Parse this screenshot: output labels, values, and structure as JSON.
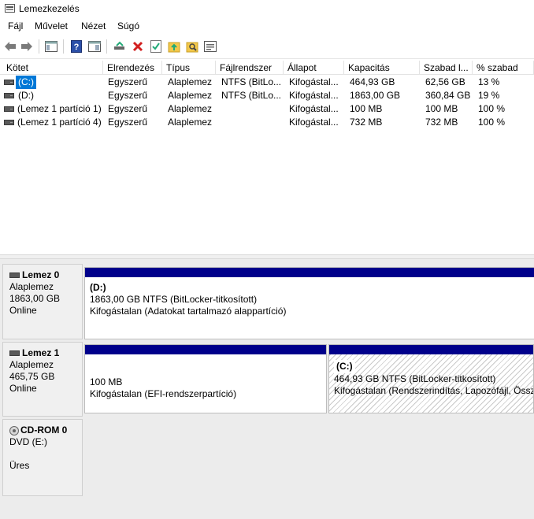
{
  "window": {
    "title": "Lemezkezelés"
  },
  "menu": [
    "Fájl",
    "Művelet",
    "Nézet",
    "Súgó"
  ],
  "toolbar": {
    "icons": [
      "back-arrow-icon",
      "forward-arrow-icon",
      "console-tree-icon",
      "help-icon",
      "show-pane-icon",
      "connect-icon",
      "delete-icon",
      "properties-icon",
      "folder-up-icon",
      "search-icon",
      "settings-list-icon"
    ]
  },
  "columns": [
    "Kötet",
    "Elrendezés",
    "Típus",
    "Fájlrendszer",
    "Állapot",
    "Kapacitás",
    "Szabad l...",
    "% szabad"
  ],
  "volumes": [
    {
      "name": "(C:)",
      "layout": "Egyszerű",
      "type": "Alaplemez",
      "fs": "NTFS (BitLo...",
      "status": "Kifogástal...",
      "capacity": "464,93 GB",
      "free": "62,56 GB",
      "pct": "13 %"
    },
    {
      "name": "(D:)",
      "layout": "Egyszerű",
      "type": "Alaplemez",
      "fs": "NTFS (BitLo...",
      "status": "Kifogástal...",
      "capacity": "1863,00 GB",
      "free": "360,84 GB",
      "pct": "19 %"
    },
    {
      "name": "(Lemez 1 partíció 1)",
      "layout": "Egyszerű",
      "type": "Alaplemez",
      "fs": "",
      "status": "Kifogástal...",
      "capacity": "100 MB",
      "free": "100 MB",
      "pct": "100 %"
    },
    {
      "name": "(Lemez 1 partíció 4)",
      "layout": "Egyszerű",
      "type": "Alaplemez",
      "fs": "",
      "status": "Kifogástal...",
      "capacity": "732 MB",
      "free": "732 MB",
      "pct": "100 %"
    }
  ],
  "disks": [
    {
      "name": "Lemez 0",
      "type": "Alaplemez",
      "size": "1863,00 GB",
      "status": "Online",
      "partitions": [
        {
          "title": "(D:)",
          "line1": "1863,00 GB NTFS (BitLocker-titkosított)",
          "line2": "Kifogástalan (Adatokat tartalmazó alappartíció)"
        }
      ]
    },
    {
      "name": "Lemez 1",
      "type": "Alaplemez",
      "size": "465,75 GB",
      "status": "Online",
      "partitions": [
        {
          "title": "",
          "line1": "100 MB",
          "line2": "Kifogástalan (EFI-rendszerpartíció)"
        },
        {
          "title": "(C:)",
          "line1": "464,93 GB NTFS (BitLocker-titkosított)",
          "line2": "Kifogástalan (Rendszerindítás, Lapozófájl, Összeo"
        }
      ]
    },
    {
      "name": "CD-ROM 0",
      "type": "DVD (E:)",
      "status": "Üres"
    }
  ],
  "colors": {
    "partition_bar": "#00008b",
    "selection": "#0078d7"
  }
}
